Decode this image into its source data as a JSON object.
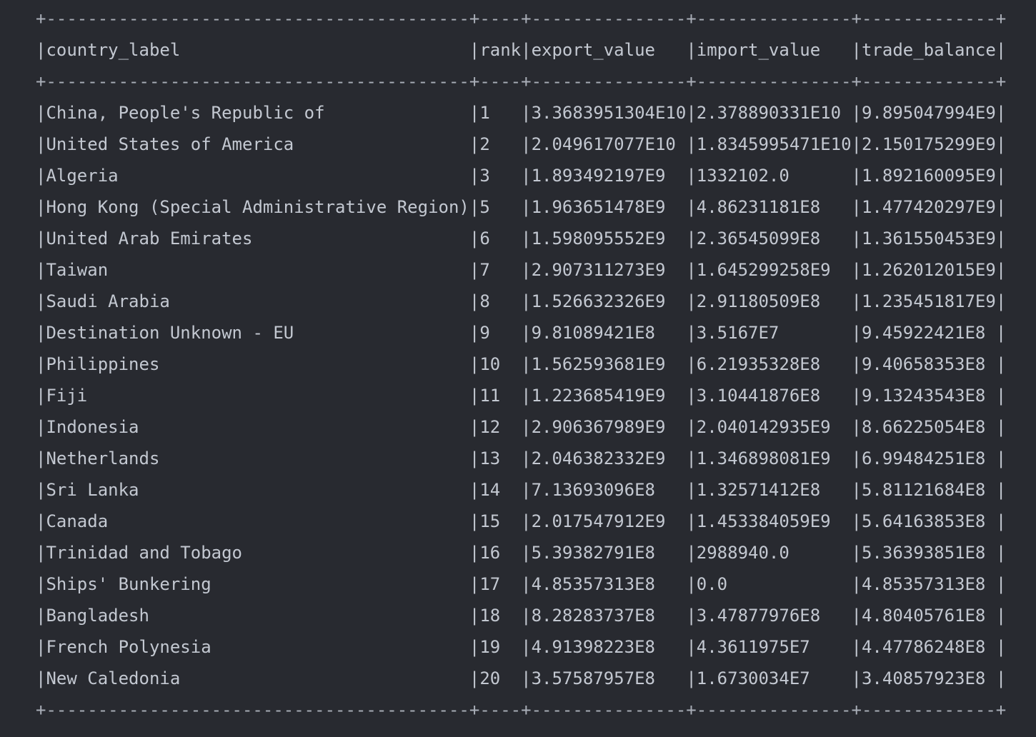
{
  "table": {
    "columns": [
      "country_label",
      "rank",
      "export_value",
      "import_value",
      "trade_balance"
    ],
    "rows": [
      [
        "China, People's Republic of",
        "1",
        "3.3683951304E10",
        "2.378890331E10",
        "9.895047994E9"
      ],
      [
        "United States of America",
        "2",
        "2.049617077E10",
        "1.8345995471E10",
        "2.150175299E9"
      ],
      [
        "Algeria",
        "3",
        "1.893492197E9",
        "1332102.0",
        "1.892160095E9"
      ],
      [
        "Hong Kong (Special Administrative Region)",
        "5",
        "1.963651478E9",
        "4.86231181E8",
        "1.477420297E9"
      ],
      [
        "United Arab Emirates",
        "6",
        "1.598095552E9",
        "2.36545099E8",
        "1.361550453E9"
      ],
      [
        "Taiwan",
        "7",
        "2.907311273E9",
        "1.645299258E9",
        "1.262012015E9"
      ],
      [
        "Saudi Arabia",
        "8",
        "1.526632326E9",
        "2.91180509E8",
        "1.235451817E9"
      ],
      [
        "Destination Unknown - EU",
        "9",
        "9.81089421E8",
        "3.5167E7",
        "9.45922421E8"
      ],
      [
        "Philippines",
        "10",
        "1.562593681E9",
        "6.21935328E8",
        "9.40658353E8"
      ],
      [
        "Fiji",
        "11",
        "1.223685419E9",
        "3.10441876E8",
        "9.13243543E8"
      ],
      [
        "Indonesia",
        "12",
        "2.906367989E9",
        "2.040142935E9",
        "8.66225054E8"
      ],
      [
        "Netherlands",
        "13",
        "2.046382332E9",
        "1.346898081E9",
        "6.99484251E8"
      ],
      [
        "Sri Lanka",
        "14",
        "7.13693096E8",
        "1.32571412E8",
        "5.81121684E8"
      ],
      [
        "Canada",
        "15",
        "2.017547912E9",
        "1.453384059E9",
        "5.64163853E8"
      ],
      [
        "Trinidad and Tobago",
        "16",
        "5.39382791E8",
        "2988940.0",
        "5.36393851E8"
      ],
      [
        "Ships' Bunkering",
        "17",
        "4.85357313E8",
        "0.0",
        "4.85357313E8"
      ],
      [
        "Bangladesh",
        "18",
        "8.28283737E8",
        "3.47877976E8",
        "4.80405761E8"
      ],
      [
        "French Polynesia",
        "19",
        "4.91398223E8",
        "4.3611975E7",
        "4.47786248E8"
      ],
      [
        "New Caledonia",
        "20",
        "3.57587957E8",
        "1.6730034E7",
        "3.40857923E8"
      ]
    ]
  }
}
